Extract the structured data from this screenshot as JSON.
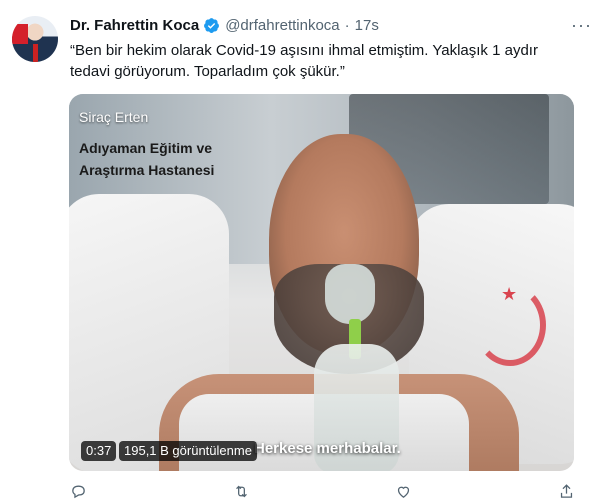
{
  "tweet": {
    "author_name": "Dr. Fahrettin Koca",
    "handle": "@drfahrettinkoca",
    "separator": "·",
    "time": "17s",
    "text": "“Ben bir hekim olarak Covid-19 aşısını ihmal etmiştim. Yaklaşık 1 aydır tedavi görüyorum. Toparladım çok şükür.”",
    "more_icon": "more-horizontal-icon"
  },
  "video": {
    "overlay_name": "Siraç Erten",
    "overlay_hospital_line1": "Adıyaman Eğitim ve",
    "overlay_hospital_line2": "Araştırma Hastanesi",
    "subtitle": "Herkese merhabalar.",
    "duration": "0:37",
    "views": "195,1 B görüntülenme"
  },
  "actions": {
    "reply_icon": "reply-icon",
    "retweet_icon": "retweet-icon",
    "like_icon": "like-icon",
    "share_icon": "share-icon"
  },
  "colors": {
    "verified": "#1d9bf0",
    "secondary_text": "#536471",
    "primary_text": "#0f1419"
  }
}
